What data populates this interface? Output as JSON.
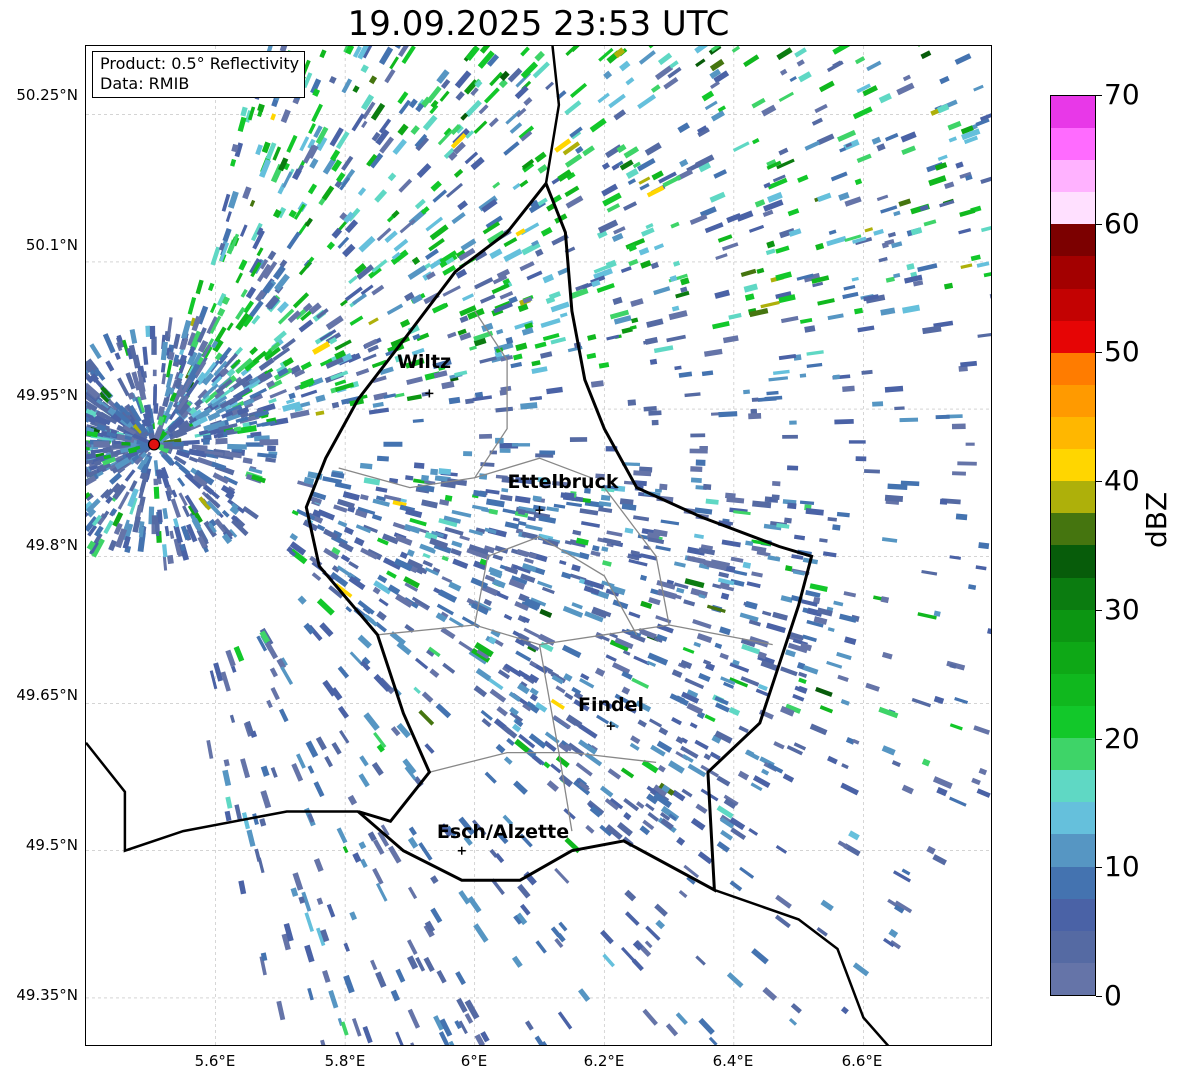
{
  "title": "19.09.2025 23:53 UTC",
  "info": {
    "product": "Product: 0.5° Reflectivity",
    "data": "Data: RMIB"
  },
  "lat_ticks": [
    "50.25°N",
    "50.1°N",
    "49.95°N",
    "49.8°N",
    "49.65°N",
    "49.5°N",
    "49.35°N"
  ],
  "lon_ticks": [
    "5.6°E",
    "5.8°E",
    "6°E",
    "6.2°E",
    "6.4°E",
    "6.6°E"
  ],
  "cities": [
    {
      "name": "Wiltz",
      "lon": 5.93,
      "lat": 49.966
    },
    {
      "name": "Ettelbruck",
      "lon": 6.1,
      "lat": 49.847
    },
    {
      "name": "Findel",
      "lon": 6.21,
      "lat": 49.627
    },
    {
      "name": "Esch/Alzette",
      "lon": 5.98,
      "lat": 49.5
    }
  ],
  "radar_site": {
    "lon": 5.505,
    "lat": 49.914,
    "color": "#e01010"
  },
  "colorbar": {
    "label": "dBZ",
    "ticks": [
      "0",
      "10",
      "20",
      "30",
      "40",
      "50",
      "60",
      "70"
    ],
    "min": 0,
    "max": 70,
    "step": 2.5,
    "colors": [
      "#6574a8",
      "#556aa3",
      "#4a62a6",
      "#4473b0",
      "#5696c3",
      "#65c0dc",
      "#5fd8c4",
      "#3ed468",
      "#12c82a",
      "#10b81e",
      "#0ea816",
      "#0c9612",
      "#0b7c10",
      "#075c0a",
      "#45750f",
      "#aeb00a",
      "#ffd600",
      "#ffb700",
      "#ff9a00",
      "#ff7c00",
      "#e60505",
      "#c30202",
      "#a30000",
      "#7c0000",
      "#ffe0ff",
      "#ffb2ff",
      "#ff6bff",
      "#e838e8"
    ]
  },
  "map_style": {
    "border_color": "#000000",
    "canton_color": "#888888",
    "grid_color": "#bbbbbb"
  }
}
